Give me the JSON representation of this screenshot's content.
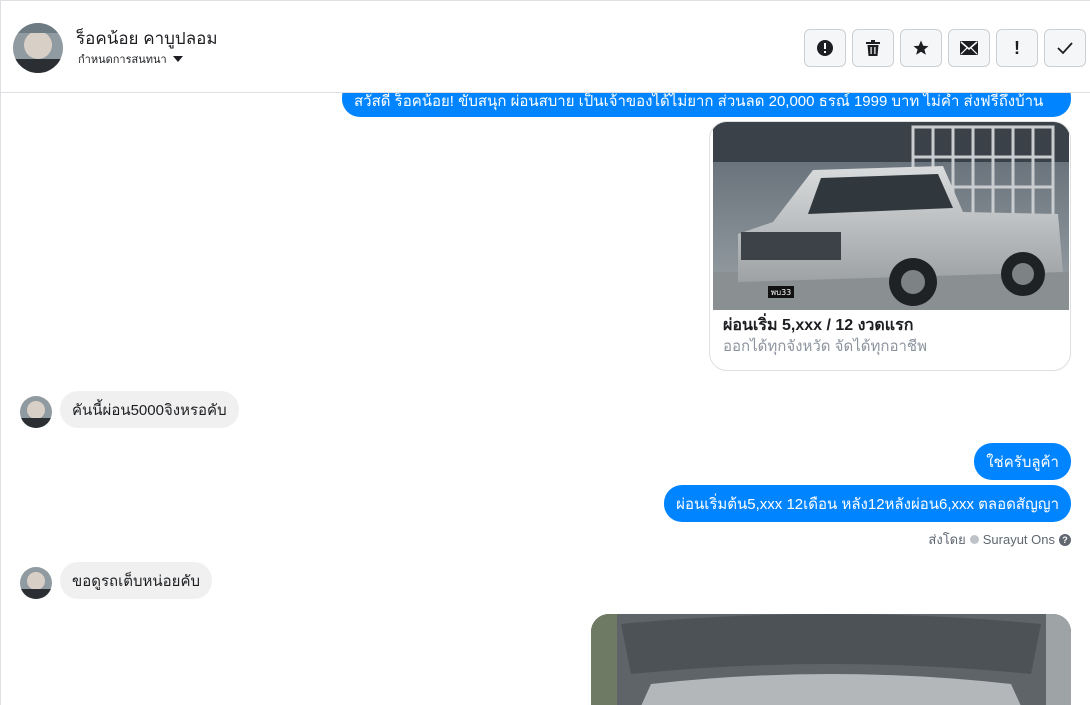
{
  "header": {
    "name": "ร็อคน้อย คาบูปลอม",
    "subtitle": "กำหนดการสนทนา"
  },
  "actions": [
    {
      "icon": "alert-icon",
      "glyph": "!"
    },
    {
      "icon": "trash-icon",
      "glyph": ""
    },
    {
      "icon": "star-icon",
      "glyph": "★"
    },
    {
      "icon": "mail-icon",
      "glyph": "✉"
    },
    {
      "icon": "exclamation-icon",
      "glyph": "!"
    },
    {
      "icon": "check-icon",
      "glyph": "✓"
    }
  ],
  "messages": {
    "greeting": "สวัสดี ร็อคน้อย! ขับสนุก ผ่อนสบาย เป็นเจ้าของได้ไม่ยาก ส่วนลด 20,000  ธรณ์ 1999 บาท ไม่ค้ำ ส่งฟรีถึงบ้าน",
    "card_title": "ผ่อนเริ่ม 5,xxx / 12 งวดแรก",
    "card_desc": "ออกได้ทุกจังหวัด จัดได้ทุกอาชีพ",
    "card_plate": "พบ33",
    "in_1": "คันนี้ผ่อน5000จิงหรอคับ",
    "out_1": "ใช่ครับลูค้า",
    "out_2": "ผ่อนเริ่มต้น5,xxx 12เดือน หลัง12หลังผ่อน6,xxx ตลอดสัญญา",
    "sent_by_label": "ส่งโดย",
    "sent_by_name": "Surayut Ons",
    "in_2": "ขอดูรถเต็บหน่อยคับ"
  },
  "colors": {
    "accent": "#0084ff",
    "incoming": "#f0f0f0"
  }
}
